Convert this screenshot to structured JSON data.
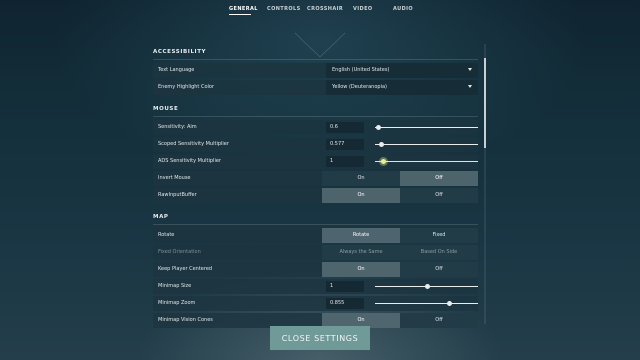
{
  "nav": {
    "tabs": [
      {
        "label": "GENERAL",
        "active": true
      },
      {
        "label": "CONTROLS",
        "active": false
      },
      {
        "label": "CROSSHAIR",
        "active": false
      },
      {
        "label": "VIDEO",
        "active": false
      },
      {
        "label": "AUDIO",
        "active": false
      }
    ]
  },
  "sections": {
    "accessibility": {
      "title": "ACCESSIBILITY",
      "text_language": {
        "label": "Text Language",
        "value": "English (United States)"
      },
      "enemy_highlight": {
        "label": "Enemy Highlight Color",
        "value": "Yellow (Deuteranopia)"
      }
    },
    "mouse": {
      "title": "MOUSE",
      "sens_aim": {
        "label": "Sensitivity: Aim",
        "value": "0.6",
        "level": 0.03
      },
      "scoped_mult": {
        "label": "Scoped Sensitivity Multiplier",
        "value": "0.577",
        "level": 0.06
      },
      "ads_mult": {
        "label": "ADS Sensitivity Multiplier",
        "value": "1",
        "level": 0.08
      },
      "invert_mouse": {
        "label": "Invert Mouse",
        "options": [
          "On",
          "Off"
        ],
        "selected": "Off"
      },
      "raw_input": {
        "label": "RawInputBuffer",
        "options": [
          "On",
          "Off"
        ],
        "selected": "On"
      }
    },
    "map": {
      "title": "MAP",
      "rotate": {
        "label": "Rotate",
        "options": [
          "Rotate",
          "Fixed"
        ],
        "selected": "Rotate"
      },
      "fixed_orientation": {
        "label": "Fixed Orientation",
        "options": [
          "Always the Same",
          "Based On Side"
        ],
        "selected": "Always the Same"
      },
      "keep_centered": {
        "label": "Keep Player Centered",
        "options": [
          "On",
          "Off"
        ],
        "selected": "On"
      },
      "minimap_size": {
        "label": "Minimap Size",
        "value": "1",
        "level": 0.5
      },
      "minimap_zoom": {
        "label": "Minimap Zoom",
        "value": "0.855",
        "level": 0.72
      },
      "minimap_vision": {
        "label": "Minimap Vision Cones",
        "options": [
          "On",
          "Off"
        ],
        "selected": "On"
      }
    }
  },
  "footer": {
    "close_label": "CLOSE SETTINGS"
  },
  "colors": {
    "accent_button": "#6f9a98",
    "highlight_yellow": "#e6f08a"
  }
}
